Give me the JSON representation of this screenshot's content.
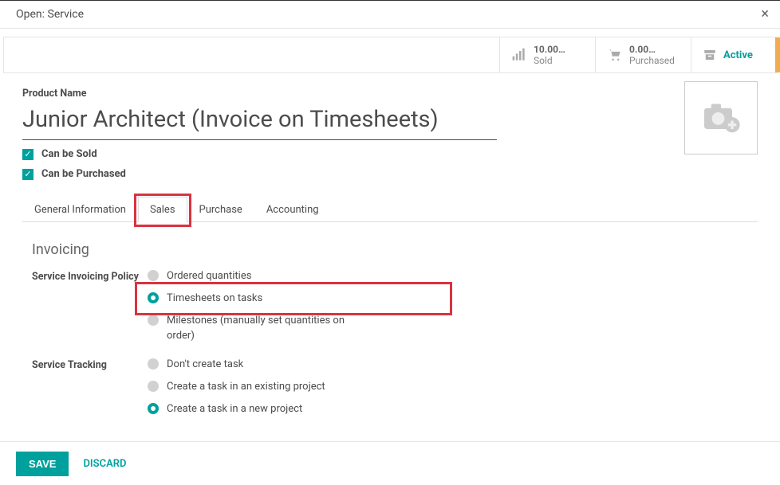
{
  "modal": {
    "title": "Open: Service",
    "close": "×"
  },
  "stats": {
    "sold_num": "10.00…",
    "sold_label": "Sold",
    "purchased_num": "0.00…",
    "purchased_label": "Purchased",
    "active_label": "Active"
  },
  "form": {
    "product_name_label": "Product Name",
    "product_name": "Junior Architect (Invoice on Timesheets)",
    "can_be_sold": "Can be Sold",
    "can_be_purchased": "Can be Purchased"
  },
  "tabs": {
    "general": "General Information",
    "sales": "Sales",
    "purchase": "Purchase",
    "accounting": "Accounting"
  },
  "invoicing": {
    "title": "Invoicing",
    "policy_label": "Service Invoicing Policy",
    "opt_ordered": "Ordered quantities",
    "opt_timesheets": "Timesheets on tasks",
    "opt_milestones": "Milestones (manually set quantities on order)",
    "tracking_label": "Service Tracking",
    "opt_no_task": "Don't create task",
    "opt_existing": "Create a task in an existing project",
    "opt_new": "Create a task in a new project"
  },
  "footer": {
    "save": "SAVE",
    "discard": "DISCARD"
  }
}
